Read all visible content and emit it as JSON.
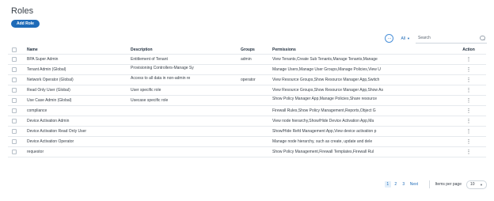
{
  "header": {
    "title": "Roles",
    "add_button": "Add Role"
  },
  "toolbar": {
    "more_icon": "more-horizontal-icon",
    "filter_value": "All",
    "search_placeholder": "Search"
  },
  "table": {
    "columns": {
      "name": "Name",
      "description": "Description",
      "groups": "Groups",
      "permissions": "Permissions",
      "action": "Action"
    },
    "rows": [
      {
        "name": "BPA Super Admin",
        "description": "Entitlement of Tenant",
        "groups": "admin",
        "permissions": "View Tenants,Create Sub Tenants,Manage Tenants,Manage",
        "action": "⋮"
      },
      {
        "name": "Tenant Admin (Global)",
        "description": "Provisioning Controllers-Manage Sy",
        "groups": "",
        "permissions": "Manage Users,Manage User Groups,Manage Policies,View U",
        "action": "⋮"
      },
      {
        "name": "Network Operator (Global)",
        "description": "Access to all data in non-admin re",
        "groups": "operator",
        "permissions": "View Resource Groups,Show Resource Manager App,Switch",
        "action": "⋮"
      },
      {
        "name": "Read Only User (Global)",
        "description": "User specific role",
        "groups": "",
        "permissions": "View Resource Groups,Show Resource Manager App,Show As",
        "action": "⋮"
      },
      {
        "name": "Use Case Admin (Global)",
        "description": "Usecase specific role",
        "groups": "",
        "permissions": "Show Policy Manager App,Manage Policies,Share resource",
        "action": "⋮"
      },
      {
        "name": "compliance",
        "description": "",
        "groups": "",
        "permissions": "Firewall Rules,Show Policy Management,Reports,Object G",
        "action": "⋮"
      },
      {
        "name": "Device Activation Admin",
        "description": "",
        "groups": "",
        "permissions": "View node hierarchy,Show/Hide Device Activation App,Ma",
        "action": "⋮"
      },
      {
        "name": "Device Activation Read Only User",
        "description": "",
        "groups": "",
        "permissions": "Show/Hide Refd Management App,View device activation p",
        "action": "⋮"
      },
      {
        "name": "Device Activation Operator",
        "description": "",
        "groups": "",
        "permissions": "Manage node hierarchy, such as create, update and dele",
        "action": "⋮"
      },
      {
        "name": "requestor",
        "description": "",
        "groups": "",
        "permissions": "Show Policy Management,Firewall Templates,Firewall Rul",
        "action": "⋮"
      }
    ]
  },
  "pagination": {
    "pages": [
      "1",
      "2",
      "3"
    ],
    "current_page": "1",
    "next_label": "Next",
    "items_per_page_label": "Items per page",
    "items_per_page_value": "10"
  },
  "colors": {
    "primary": "#1e6bb8",
    "text": "#39414a",
    "border": "#e6eaee"
  }
}
